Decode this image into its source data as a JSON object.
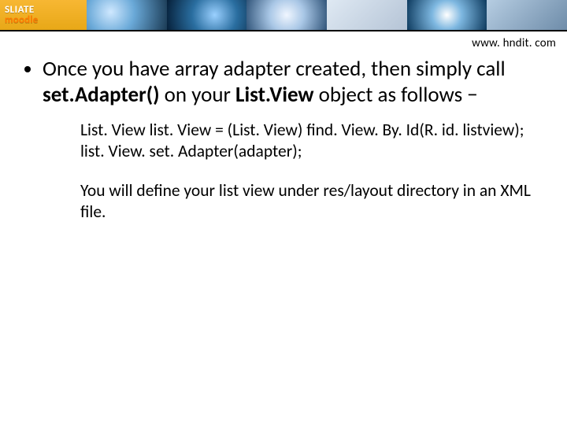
{
  "header": {
    "logo_top": "SLIATE",
    "logo_bot": "moodle"
  },
  "url": "www. hndit. com",
  "bullet": {
    "pre": "Once you have array adapter created, then simply call ",
    "bold1": "set.Adapter()",
    "mid": " on your ",
    "bold2": "List.View",
    "post": " object as follows −"
  },
  "code": {
    "line1": "List. View list. View = (List. View) find. View. By. Id(R. id. listview);",
    "line2": "list. View. set. Adapter(adapter);"
  },
  "desc": "You will define your list view under res/layout directory in an XML file."
}
